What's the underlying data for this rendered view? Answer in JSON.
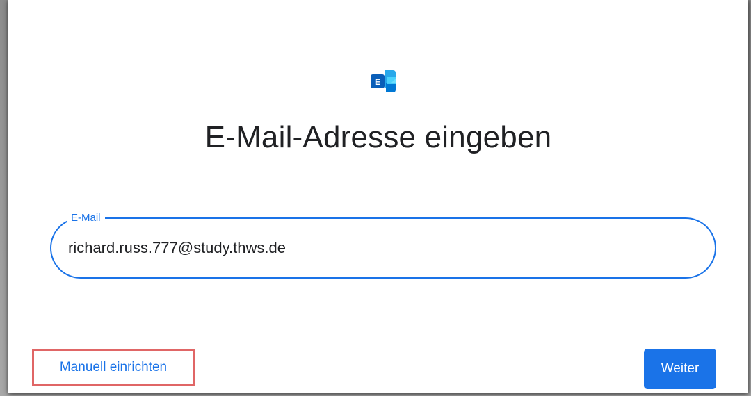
{
  "app": {
    "logo_icon": "microsoft-exchange-icon",
    "title": "E-Mail-Adresse eingeben"
  },
  "email_field": {
    "label": "E-Mail",
    "value": "richard.russ.777@study.thws.de"
  },
  "actions": {
    "manual_setup_label": "Manuell einrichten",
    "next_label": "Weiter"
  },
  "colors": {
    "accent": "#1a73e8",
    "highlight": "#e06666",
    "text": "#202124"
  }
}
